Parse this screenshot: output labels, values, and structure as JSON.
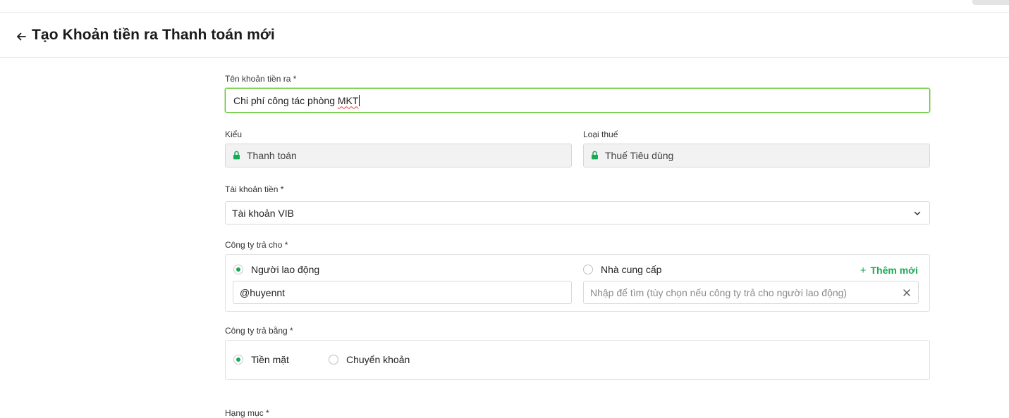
{
  "header": {
    "title": "Tạo Khoản tiền ra Thanh toán mới"
  },
  "form": {
    "name": {
      "label": "Tên khoản tiền ra *",
      "value_plain": "Chi phí công tác phòng ",
      "value_flagged": "MKT"
    },
    "type": {
      "label": "Kiểu",
      "value": "Thanh toán"
    },
    "tax_type": {
      "label": "Loại thuế",
      "value": "Thuế Tiêu dùng"
    },
    "money_account": {
      "label": "Tài khoản tiền *",
      "value": "Tài khoản VIB"
    },
    "pay_to": {
      "label": "Công ty trả cho *",
      "option_employee": "Người lao động",
      "option_supplier": "Nhà cung cấp",
      "selected": "Người lao động",
      "employee_value": "@huyennt",
      "supplier_placeholder": "Nhập để tìm (tùy chọn nếu công ty trả cho người lao động)",
      "add_new": "Thêm mới"
    },
    "pay_by": {
      "label": "Công ty trả bằng *",
      "option_cash": "Tiền mặt",
      "option_transfer": "Chuyển khoản",
      "selected": "Tiền mặt"
    },
    "category": {
      "label": "Hạng mục *"
    }
  },
  "colors": {
    "accent": "#1aaa55",
    "focus_border": "#52c41a",
    "locked_bg": "#f2f2f2",
    "border": "#d9d9d9"
  },
  "icons": {
    "back": "arrow-left-icon",
    "lock": "lock-icon",
    "dropdown": "chevron-down-icon",
    "clear": "close-icon",
    "add": "plus-icon"
  }
}
